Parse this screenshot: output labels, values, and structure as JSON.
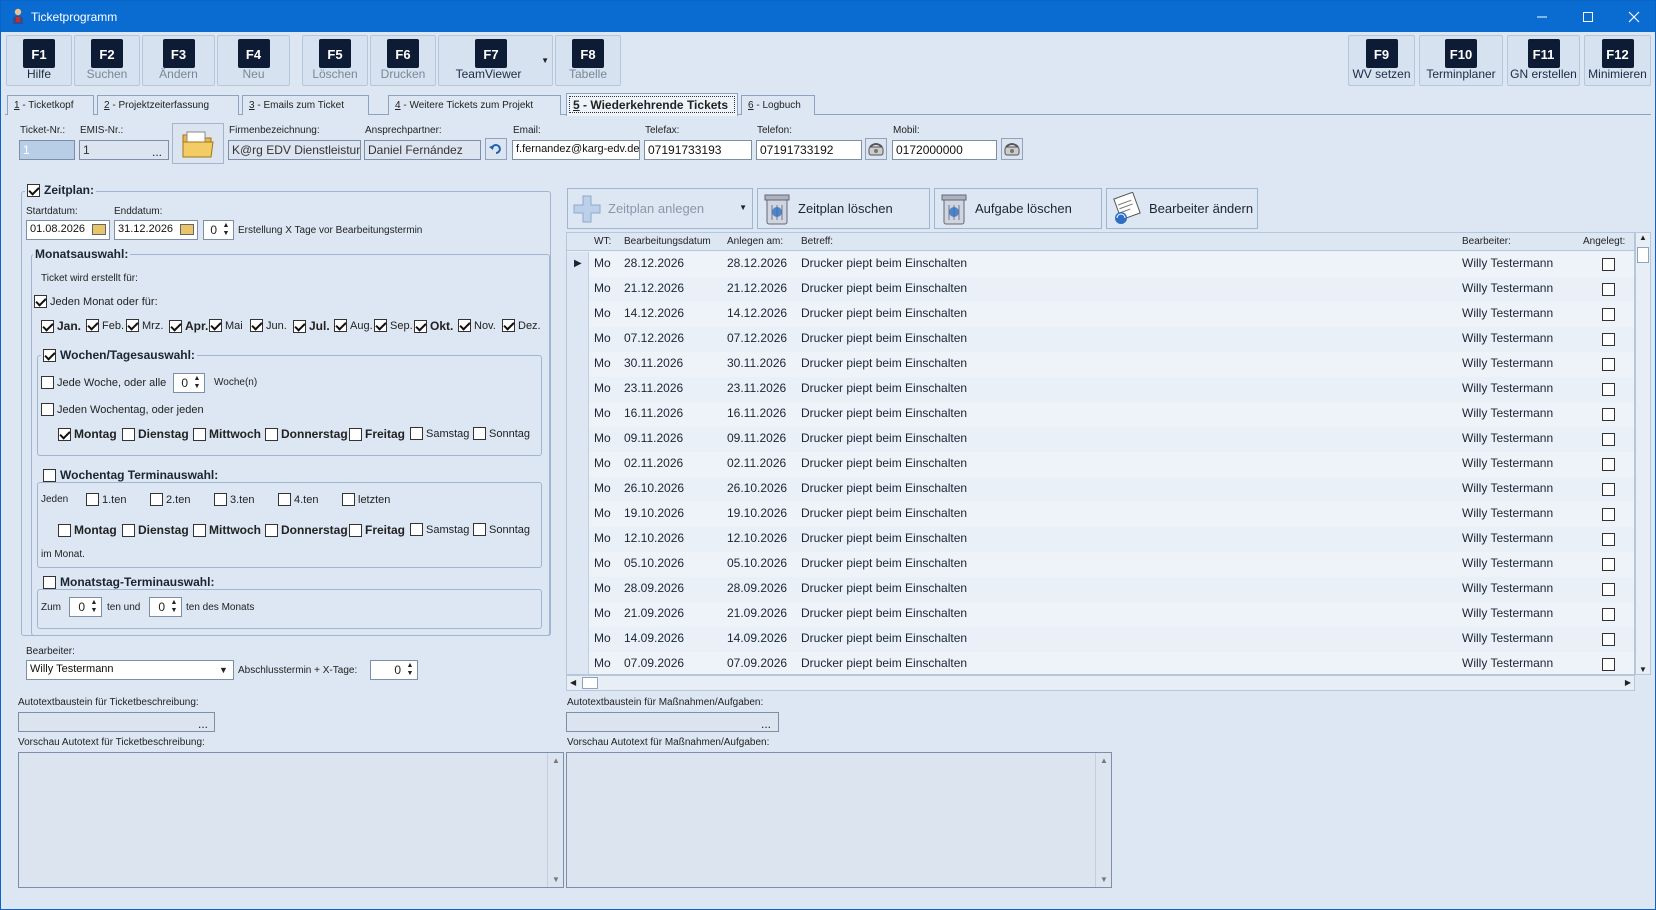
{
  "window": {
    "title": "Ticketprogramm"
  },
  "fkeys": [
    {
      "key": "F1",
      "label": "Hilfe"
    },
    {
      "key": "F2",
      "label": "Suchen"
    },
    {
      "key": "F3",
      "label": "Ändern"
    },
    {
      "key": "F4",
      "label": "Neu"
    },
    {
      "key": "F5",
      "label": "Löschen"
    },
    {
      "key": "F6",
      "label": "Drucken"
    },
    {
      "key": "F7",
      "label": "TeamViewer"
    },
    {
      "key": "F8",
      "label": "Tabelle"
    },
    {
      "key": "F9",
      "label": "WV setzen"
    },
    {
      "key": "F10",
      "label": "Terminplaner"
    },
    {
      "key": "F11",
      "label": "GN erstellen"
    },
    {
      "key": "F12",
      "label": "Minimieren"
    }
  ],
  "tabs": [
    {
      "num": "1",
      "label": " - Ticketkopf"
    },
    {
      "num": "2",
      "label": " - Projektzeiterfassung"
    },
    {
      "num": "3",
      "label": " - Emails zum Ticket"
    },
    {
      "num": "4",
      "label": " - Weitere Tickets zum Projekt"
    },
    {
      "num": "5",
      "label": " - Wiederkehrende Tickets"
    },
    {
      "num": "6",
      "label": " - Logbuch"
    }
  ],
  "header": {
    "ticket_nr_label": "Ticket-Nr.:",
    "ticket_nr": "1",
    "emis_label": "EMIS-Nr.:",
    "emis": "1",
    "emis_btn": "...",
    "firma_label": "Firmenbezeichnung:",
    "firma": "K@rg EDV Dienstleistungen",
    "ansprech_label": "Ansprechpartner:",
    "ansprech": "Daniel Fernández",
    "email_label": "Email:",
    "email": "f.fernandez@karg-edv.de",
    "telefax_label": "Telefax:",
    "telefax": "07191733193",
    "telefon_label": "Telefon:",
    "telefon": "07191733192",
    "mobil_label": "Mobil:",
    "mobil": "0172000000"
  },
  "zeitplan": {
    "title": "Zeitplan:",
    "start_label": "Startdatum:",
    "start": "01.08.2026",
    "end_label": "Enddatum:",
    "end": "31.12.2026",
    "days_before": "0",
    "days_before_label": "Erstellung X Tage vor Bearbeitungstermin",
    "monat_title": "Monatsauswahl:",
    "ticket_for": "Ticket wird erstellt für:",
    "jeden_monat": "Jeden Monat oder für:",
    "months": [
      "Jan.",
      "Feb.",
      "Mrz.",
      "Apr.",
      "Mai",
      "Jun.",
      "Jul.",
      "Aug.",
      "Sep.",
      "Okt.",
      "Nov.",
      "Dez."
    ],
    "wochen_title": "Wochen/Tagesauswahl:",
    "jede_woche": "Jede Woche, oder alle",
    "woche_n": "0",
    "woche_label": "Woche(n)",
    "jeden_wochentag": "Jeden Wochentag, oder jeden",
    "days": [
      "Montag",
      "Dienstag",
      "Mittwoch",
      "Donnerstag",
      "Freitag",
      "Samstag",
      "Sonntag"
    ],
    "wt_title": "Wochentag Terminauswahl:",
    "jeden": "Jeden",
    "nth": [
      "1.ten",
      "2.ten",
      "3.ten",
      "4.ten",
      "letzten"
    ],
    "im_monat": "im Monat.",
    "mt_title": "Monatstag-Terminauswahl:",
    "zum": "Zum",
    "zum_val": "0",
    "ten_und": "ten und",
    "und_val": "0",
    "ten_des": "ten des Monats",
    "bearbeiter_label": "Bearbeiter:",
    "bearbeiter": "Willy Testermann",
    "abschluss_label": "Abschlusstermin + X-Tage:",
    "abschluss": "0"
  },
  "toolbar": {
    "anlegen": "Zeitplan anlegen",
    "loeschen": "Zeitplan löschen",
    "aufgabe": "Aufgabe löschen",
    "bearbeiter": "Bearbeiter ändern"
  },
  "grid": {
    "headers": [
      "WT:",
      "Bearbeitungsdatum",
      "Anlegen am:",
      "Betreff:",
      "Bearbeiter:",
      "Angelegt:"
    ],
    "rows": [
      [
        "Mo",
        "28.12.2026",
        "28.12.2026",
        "Drucker piept beim Einschalten",
        "Willy Testermann"
      ],
      [
        "Mo",
        "21.12.2026",
        "21.12.2026",
        "Drucker piept beim Einschalten",
        "Willy Testermann"
      ],
      [
        "Mo",
        "14.12.2026",
        "14.12.2026",
        "Drucker piept beim Einschalten",
        "Willy Testermann"
      ],
      [
        "Mo",
        "07.12.2026",
        "07.12.2026",
        "Drucker piept beim Einschalten",
        "Willy Testermann"
      ],
      [
        "Mo",
        "30.11.2026",
        "30.11.2026",
        "Drucker piept beim Einschalten",
        "Willy Testermann"
      ],
      [
        "Mo",
        "23.11.2026",
        "23.11.2026",
        "Drucker piept beim Einschalten",
        "Willy Testermann"
      ],
      [
        "Mo",
        "16.11.2026",
        "16.11.2026",
        "Drucker piept beim Einschalten",
        "Willy Testermann"
      ],
      [
        "Mo",
        "09.11.2026",
        "09.11.2026",
        "Drucker piept beim Einschalten",
        "Willy Testermann"
      ],
      [
        "Mo",
        "02.11.2026",
        "02.11.2026",
        "Drucker piept beim Einschalten",
        "Willy Testermann"
      ],
      [
        "Mo",
        "26.10.2026",
        "26.10.2026",
        "Drucker piept beim Einschalten",
        "Willy Testermann"
      ],
      [
        "Mo",
        "19.10.2026",
        "19.10.2026",
        "Drucker piept beim Einschalten",
        "Willy Testermann"
      ],
      [
        "Mo",
        "12.10.2026",
        "12.10.2026",
        "Drucker piept beim Einschalten",
        "Willy Testermann"
      ],
      [
        "Mo",
        "05.10.2026",
        "05.10.2026",
        "Drucker piept beim Einschalten",
        "Willy Testermann"
      ],
      [
        "Mo",
        "28.09.2026",
        "28.09.2026",
        "Drucker piept beim Einschalten",
        "Willy Testermann"
      ],
      [
        "Mo",
        "21.09.2026",
        "21.09.2026",
        "Drucker piept beim Einschalten",
        "Willy Testermann"
      ],
      [
        "Mo",
        "14.09.2026",
        "14.09.2026",
        "Drucker piept beim Einschalten",
        "Willy Testermann"
      ],
      [
        "Mo",
        "07.09.2026",
        "07.09.2026",
        "Drucker piept beim Einschalten",
        "Willy Testermann"
      ]
    ]
  },
  "bottom": {
    "auto_ticket_label": "Autotextbaustein für Ticketbeschreibung:",
    "auto_mass_label": "Autotextbaustein für Maßnahmen/Aufgaben:",
    "vorschau_ticket_label": "Vorschau Autotext für Ticketbeschreibung:",
    "vorschau_mass_label": "Vorschau Autotext für Maßnahmen/Aufgaben:",
    "btn": "..."
  }
}
